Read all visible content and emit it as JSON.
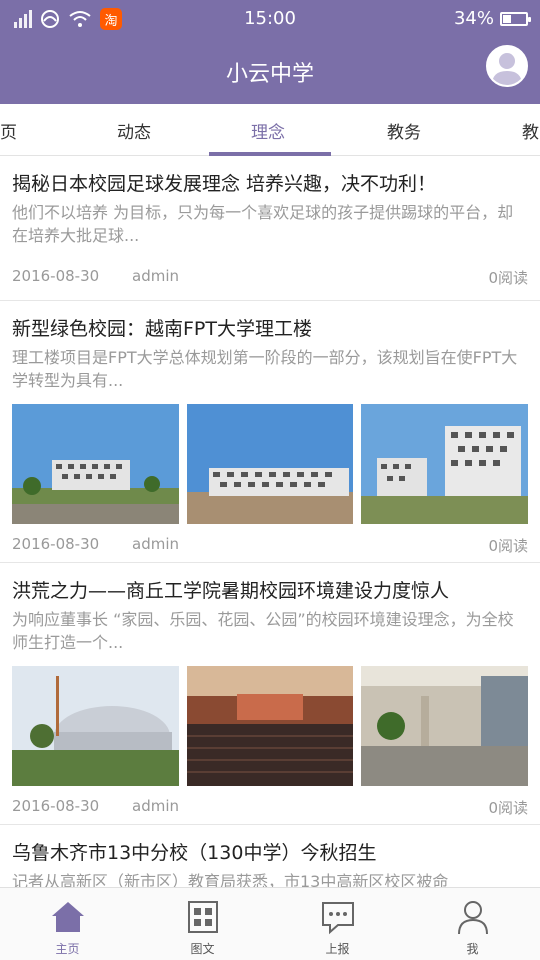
{
  "status_bar": {
    "time": "15:00",
    "battery": "34%",
    "taobao_badge": "淘",
    "icons": [
      "signal-icon",
      "china-mobile-icon",
      "wifi-icon",
      "taobao-icon",
      "battery-icon"
    ]
  },
  "header": {
    "title": "小云中学",
    "avatar_icon": "user-avatar-icon",
    "colors": {
      "brand": "#7b6fa8"
    }
  },
  "tabs": [
    {
      "label": "页"
    },
    {
      "label": "动态"
    },
    {
      "label": "理念",
      "active": true
    },
    {
      "label": "教务"
    },
    {
      "label": "教"
    }
  ],
  "articles": [
    {
      "title": "揭秘日本校园足球发展理念 培养兴趣，决不功利！",
      "summary": "他们不以培养 为目标，只为每一个喜欢足球的孩子提供踢球的平台，却在培养大批足球...",
      "date": "2016-08-30",
      "author": "admin",
      "reads": "0阅读"
    },
    {
      "title": "新型绿色校园：越南FPT大学理工楼",
      "summary": "理工楼项目是FPT大学总体规划第一阶段的一部分，该规划旨在使FPT大学转型为具有...",
      "date": "2016-08-30",
      "author": "admin",
      "reads": "0阅读"
    },
    {
      "title": "洪荒之力——商丘工学院暑期校园环境建设力度惊人",
      "summary": "为响应董事长 “家园、乐园、花园、公园”的校园环境建设理念，为全校师生打造一个...",
      "date": "2016-08-30",
      "author": "admin",
      "reads": "0阅读"
    },
    {
      "title": "乌鲁木齐市13中分校（130中学）今秋招生",
      "summary": "记者从高新区（新市区）教育局获悉，市13中高新区校区被命"
    }
  ],
  "bottom_nav": [
    {
      "label": "主页",
      "icon": "home-icon",
      "active": true
    },
    {
      "label": "图文",
      "icon": "grid-icon"
    },
    {
      "label": "上报",
      "icon": "chat-icon"
    },
    {
      "label": "我",
      "icon": "person-icon"
    }
  ]
}
